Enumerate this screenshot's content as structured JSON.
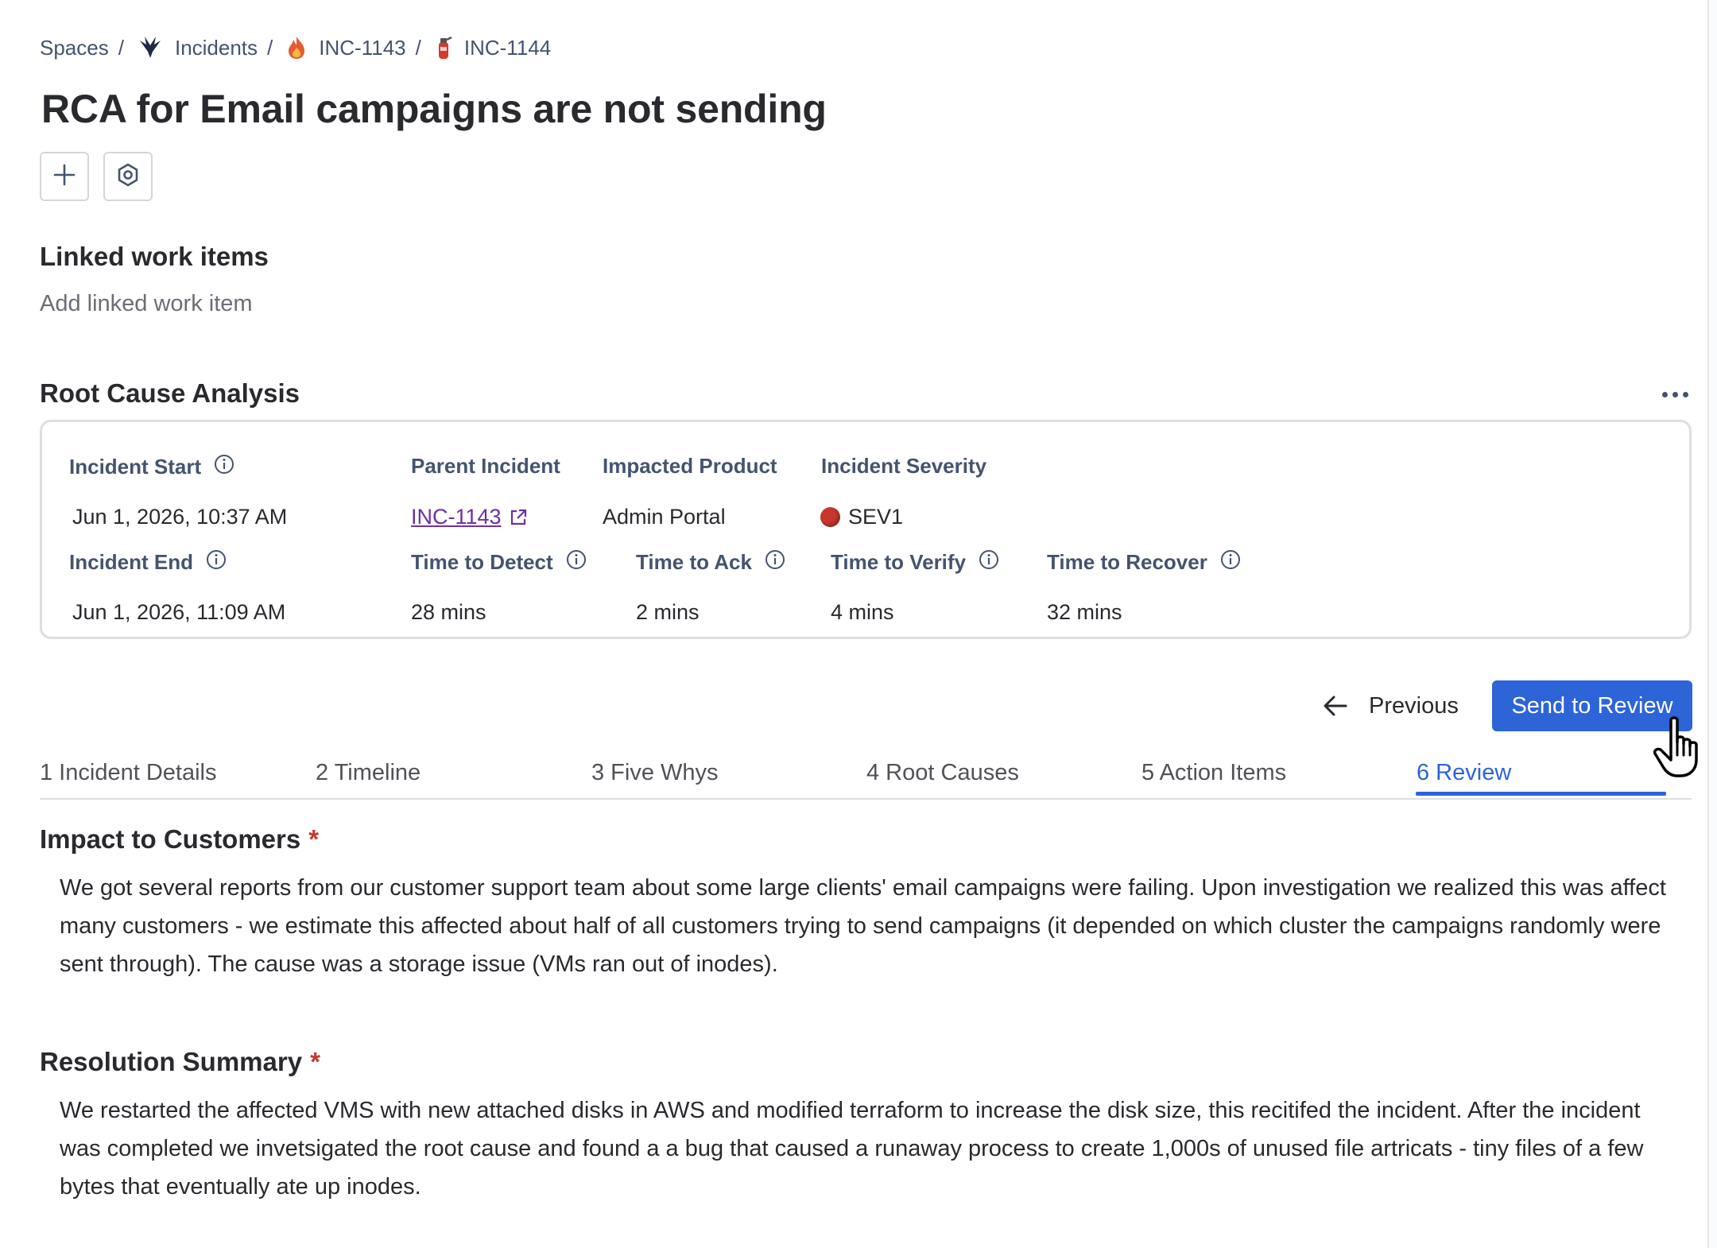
{
  "breadcrumb": {
    "items": [
      {
        "label": "Spaces",
        "icon": ""
      },
      {
        "label": "Incidents",
        "icon": "incidents-bird-icon"
      },
      {
        "label": "INC-1143",
        "icon": "fire-icon"
      },
      {
        "label": "INC-1144",
        "icon": "fire-extinguisher-icon"
      }
    ],
    "separator": "/"
  },
  "page_title": "RCA for Email campaigns are not sending",
  "toolbar": {
    "add_icon": "plus-icon",
    "settings_icon": "hexagon-settings-icon"
  },
  "linked_work_items": {
    "heading": "Linked work items",
    "add_label": "Add linked work item"
  },
  "rca": {
    "heading": "Root Cause Analysis",
    "incident_start": {
      "label": "Incident Start",
      "value": "Jun 1, 2026, 10:37 AM"
    },
    "parent_incident": {
      "label": "Parent Incident",
      "value": "INC-1143"
    },
    "impacted_product": {
      "label": "Impacted Product",
      "value": "Admin Portal"
    },
    "incident_severity": {
      "label": "Incident Severity",
      "value": "SEV1",
      "color": "#c9372c"
    },
    "incident_end": {
      "label": "Incident End",
      "value": "Jun 1, 2026, 11:09 AM"
    },
    "time_to_detect": {
      "label": "Time to Detect",
      "value": "28 mins"
    },
    "time_to_ack": {
      "label": "Time to Ack",
      "value": "2 mins"
    },
    "time_to_verify": {
      "label": "Time to Verify",
      "value": "4 mins"
    },
    "time_to_recover": {
      "label": "Time to Recover",
      "value": "32 mins"
    }
  },
  "navigation": {
    "previous_label": "Previous",
    "send_label": "Send to Review",
    "accent": "#2d64d8"
  },
  "tabs": [
    {
      "label": "1 Incident Details"
    },
    {
      "label": "2 Timeline"
    },
    {
      "label": "3 Five Whys"
    },
    {
      "label": "4 Root Causes"
    },
    {
      "label": "5 Action Items"
    },
    {
      "label": "6 Review",
      "active": true
    }
  ],
  "impact": {
    "heading": "Impact to Customers",
    "required_mark": "*",
    "text": "We got several reports from our customer support team about some large clients' email campaigns were failing. Upon investigation we realized this was affect many customers - we estimate this affected about half of all customers trying to send campaigns (it depended on which cluster the campaigns randomly were sent through). The cause was a storage issue (VMs ran out of inodes)."
  },
  "resolution": {
    "heading": "Resolution Summary",
    "required_mark": "*",
    "text": "We restarted the affected VMS with new attached disks in AWS and modified terraform to increase the disk size, this recitifed the incident. After the incident was completed we invetsigated the root cause and found a a bug that caused a runaway process to create 1,000s of unused file artricats - tiny files of a few bytes that eventually ate up inodes."
  }
}
